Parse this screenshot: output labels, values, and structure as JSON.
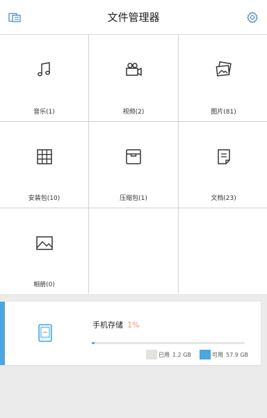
{
  "header": {
    "title": "文件管理器",
    "left_icon": "folder-transfer-icon",
    "right_icon": "gear-icon"
  },
  "categories": [
    {
      "label": "音乐(1)",
      "icon": "music-note-icon"
    },
    {
      "label": "视频(2)",
      "icon": "video-camera-icon"
    },
    {
      "label": "图片(81)",
      "icon": "photos-icon"
    },
    {
      "label": "安装包(10)",
      "icon": "app-grid-icon"
    },
    {
      "label": "压缩包(1)",
      "icon": "archive-box-icon"
    },
    {
      "label": "文档(23)",
      "icon": "document-icon"
    },
    {
      "label": "相册(0)",
      "icon": "album-icon"
    }
  ],
  "storage": {
    "name": "手机存储",
    "percent_label": "1%",
    "used_fraction": 0.02,
    "used_label": "已用",
    "used_value": "1.2 GB",
    "free_label": "可用",
    "free_value": "57.9 GB",
    "icon": "phone-storage-icon"
  },
  "colors": {
    "accent": "#4da6dd",
    "percent": "#ff8c7a",
    "used_swatch": "#e2e2de"
  }
}
